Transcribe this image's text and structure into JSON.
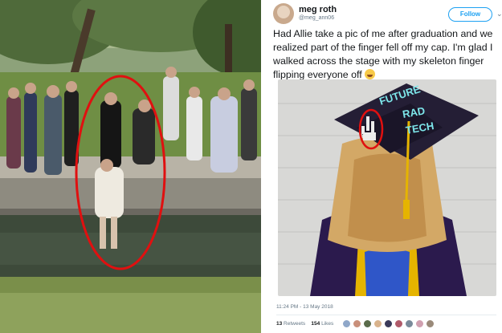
{
  "tweet": {
    "name": "meg roth",
    "handle": "@meg_ann06",
    "follow_label": "Follow",
    "text": "Had Allie take a pic of me after graduation and we realized part of the finger fell off my cap. I'm glad I walked across the stage with my skeleton finger flipping everyone off",
    "timestamp": "11:24 PM - 13 May 2018",
    "retweets_count": "13",
    "retweets_label": "Retweets",
    "likes_count": "154",
    "likes_label": "Likes"
  },
  "cap": {
    "line1": "FUTURE",
    "line2": "RAD",
    "line3": "TECH"
  },
  "colors": {
    "accent": "#1da1f2",
    "circle_red": "#e01010",
    "gown_purple": "#2b1a4d",
    "hood_gold": "#e5b400"
  },
  "icons": {
    "chevron": "chevron-down-icon",
    "emoji": "laughing-emoji-icon"
  }
}
